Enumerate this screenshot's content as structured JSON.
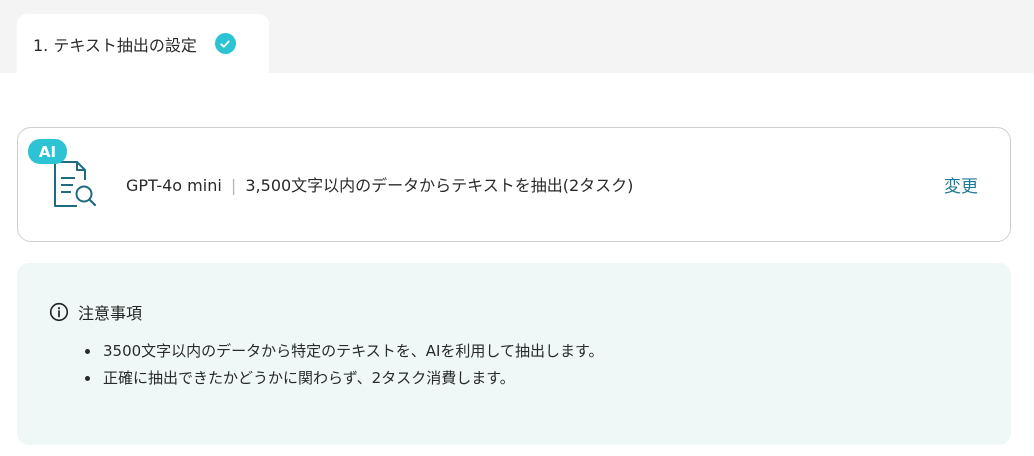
{
  "tab": {
    "label": "1. テキスト抽出の設定",
    "status_icon": "check-circle-icon",
    "accent": "#2cc3d5"
  },
  "ai_card": {
    "badge": "AI",
    "icon": "document-search-icon",
    "model": "GPT-4o mini",
    "separator": "|",
    "description": "3,500文字以内のデータからテキストを抽出(2タスク)",
    "change_label": "変更",
    "link_color": "#1f7a9a"
  },
  "notice": {
    "icon": "info-icon",
    "title": "注意事項",
    "items": [
      "3500文字以内のデータから特定のテキストを、AIを利用して抽出します。",
      "正確に抽出できたかどうかに関わらず、2タスク消費します。"
    ],
    "background": "#eff8f7"
  }
}
